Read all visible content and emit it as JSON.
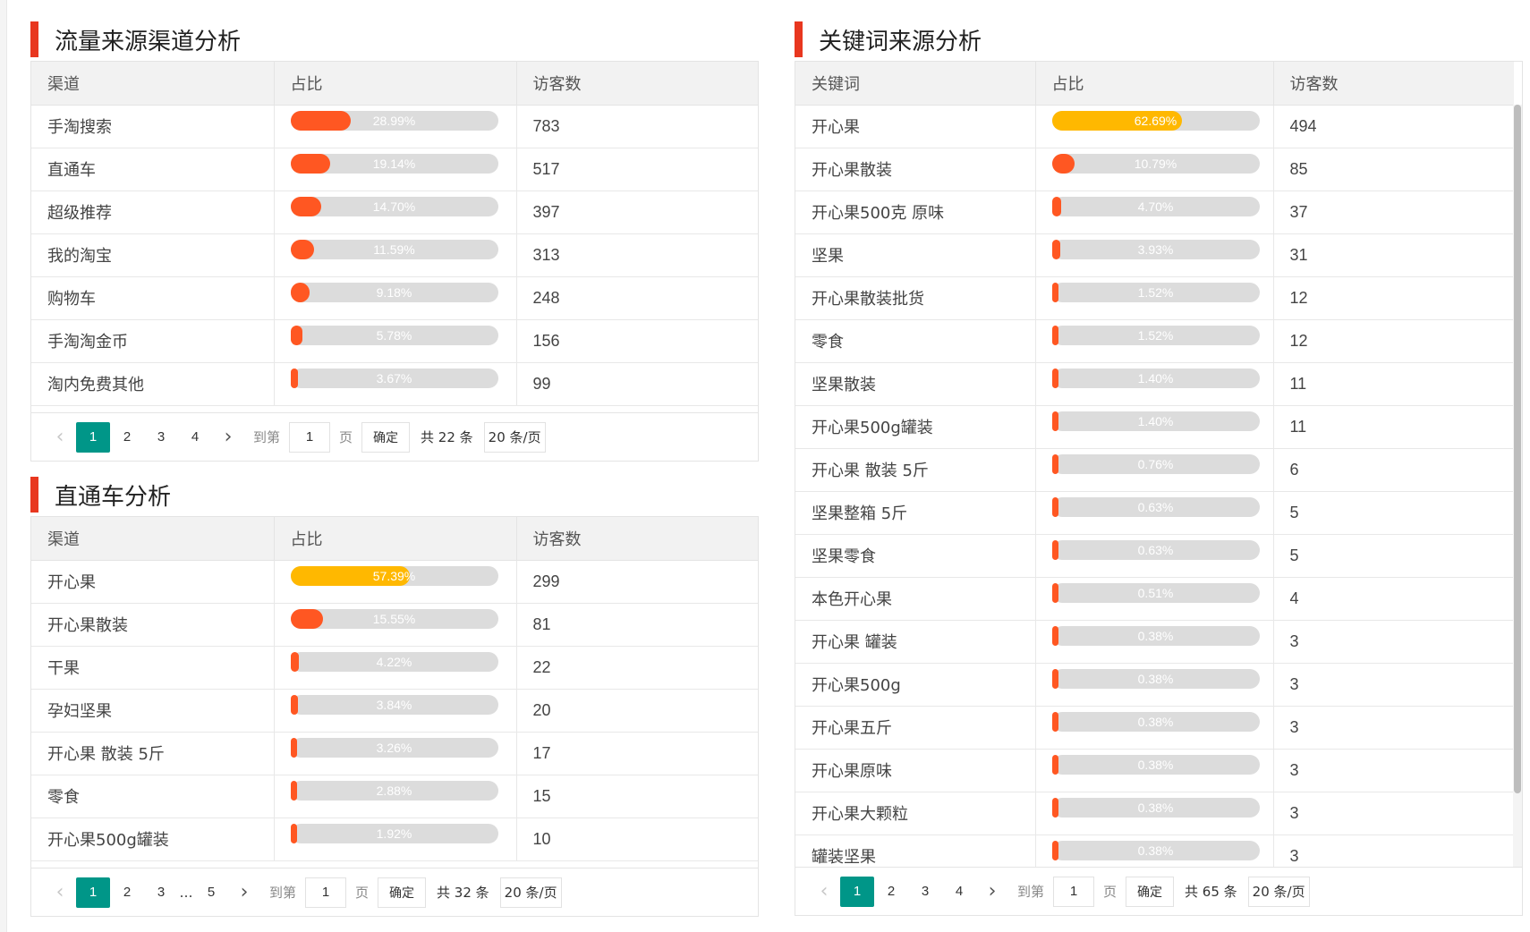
{
  "colors": {
    "accent": "#e8371f",
    "bar_high": "#ffb800",
    "bar_low": "#ff5722",
    "track": "#dcdcdc",
    "active_page": "#009688"
  },
  "traffic": {
    "title": "流量来源渠道分析",
    "headers": [
      "渠道",
      "占比",
      "访客数"
    ],
    "rows": [
      {
        "name": "手淘搜索",
        "pct": 28.99,
        "pct_label": "28.99%",
        "visitors": "783"
      },
      {
        "name": "直通车",
        "pct": 19.14,
        "pct_label": "19.14%",
        "visitors": "517"
      },
      {
        "name": "超级推荐",
        "pct": 14.7,
        "pct_label": "14.70%",
        "visitors": "397"
      },
      {
        "name": "我的淘宝",
        "pct": 11.59,
        "pct_label": "11.59%",
        "visitors": "313"
      },
      {
        "name": "购物车",
        "pct": 9.18,
        "pct_label": "9.18%",
        "visitors": "248"
      },
      {
        "name": "手淘淘金币",
        "pct": 5.78,
        "pct_label": "5.78%",
        "visitors": "156"
      },
      {
        "name": "淘内免费其他",
        "pct": 3.67,
        "pct_label": "3.67%",
        "visitors": "99"
      }
    ],
    "pager": {
      "prev": "‹",
      "next": "›",
      "pages": [
        "1",
        "2",
        "3",
        "4"
      ],
      "active": "1",
      "goto_label": "到第",
      "goto_value": "1",
      "page_unit": "页",
      "confirm": "确定",
      "total": "共 22 条",
      "page_size": "20 条/页"
    }
  },
  "ztc": {
    "title": "直通车分析",
    "headers": [
      "渠道",
      "占比",
      "访客数"
    ],
    "rows": [
      {
        "name": "开心果",
        "pct": 57.39,
        "pct_label": "57.39%",
        "visitors": "299"
      },
      {
        "name": "开心果散装",
        "pct": 15.55,
        "pct_label": "15.55%",
        "visitors": "81"
      },
      {
        "name": "干果",
        "pct": 4.22,
        "pct_label": "4.22%",
        "visitors": "22"
      },
      {
        "name": "孕妇坚果",
        "pct": 3.84,
        "pct_label": "3.84%",
        "visitors": "20"
      },
      {
        "name": "开心果 散装 5斤",
        "pct": 3.26,
        "pct_label": "3.26%",
        "visitors": "17"
      },
      {
        "name": "零食",
        "pct": 2.88,
        "pct_label": "2.88%",
        "visitors": "15"
      },
      {
        "name": "开心果500g罐装",
        "pct": 1.92,
        "pct_label": "1.92%",
        "visitors": "10"
      }
    ],
    "pager": {
      "prev": "‹",
      "next": "›",
      "pages": [
        "1",
        "2",
        "3"
      ],
      "ellipsis": "…",
      "last": "5",
      "active": "1",
      "goto_label": "到第",
      "goto_value": "1",
      "page_unit": "页",
      "confirm": "确定",
      "total": "共 32 条",
      "page_size": "20 条/页"
    }
  },
  "keywords": {
    "title": "关键词来源分析",
    "headers": [
      "关键词",
      "占比",
      "访客数"
    ],
    "rows": [
      {
        "name": "开心果",
        "pct": 62.69,
        "pct_label": "62.69%",
        "visitors": "494"
      },
      {
        "name": "开心果散装",
        "pct": 10.79,
        "pct_label": "10.79%",
        "visitors": "85"
      },
      {
        "name": "开心果500克 原味",
        "pct": 4.7,
        "pct_label": "4.70%",
        "visitors": "37"
      },
      {
        "name": "坚果",
        "pct": 3.93,
        "pct_label": "3.93%",
        "visitors": "31"
      },
      {
        "name": "开心果散装批货",
        "pct": 1.52,
        "pct_label": "1.52%",
        "visitors": "12"
      },
      {
        "name": "零食",
        "pct": 1.52,
        "pct_label": "1.52%",
        "visitors": "12"
      },
      {
        "name": "坚果散装",
        "pct": 1.4,
        "pct_label": "1.40%",
        "visitors": "11"
      },
      {
        "name": "开心果500g罐装",
        "pct": 1.4,
        "pct_label": "1.40%",
        "visitors": "11"
      },
      {
        "name": "开心果 散装 5斤",
        "pct": 0.76,
        "pct_label": "0.76%",
        "visitors": "6"
      },
      {
        "name": "坚果整箱 5斤",
        "pct": 0.63,
        "pct_label": "0.63%",
        "visitors": "5"
      },
      {
        "name": "坚果零食",
        "pct": 0.63,
        "pct_label": "0.63%",
        "visitors": "5"
      },
      {
        "name": "本色开心果",
        "pct": 0.51,
        "pct_label": "0.51%",
        "visitors": "4"
      },
      {
        "name": "开心果 罐装",
        "pct": 0.38,
        "pct_label": "0.38%",
        "visitors": "3"
      },
      {
        "name": "开心果500g",
        "pct": 0.38,
        "pct_label": "0.38%",
        "visitors": "3"
      },
      {
        "name": "开心果五斤",
        "pct": 0.38,
        "pct_label": "0.38%",
        "visitors": "3"
      },
      {
        "name": "开心果原味",
        "pct": 0.38,
        "pct_label": "0.38%",
        "visitors": "3"
      },
      {
        "name": "开心果大颗粒",
        "pct": 0.38,
        "pct_label": "0.38%",
        "visitors": "3"
      },
      {
        "name": "罐装坚果",
        "pct": 0.38,
        "pct_label": "0.38%",
        "visitors": "3"
      }
    ],
    "pager": {
      "prev": "‹",
      "next": "›",
      "pages": [
        "1",
        "2",
        "3",
        "4"
      ],
      "active": "1",
      "goto_label": "到第",
      "goto_value": "1",
      "page_unit": "页",
      "confirm": "确定",
      "total": "共 65 条",
      "page_size": "20 条/页"
    }
  }
}
